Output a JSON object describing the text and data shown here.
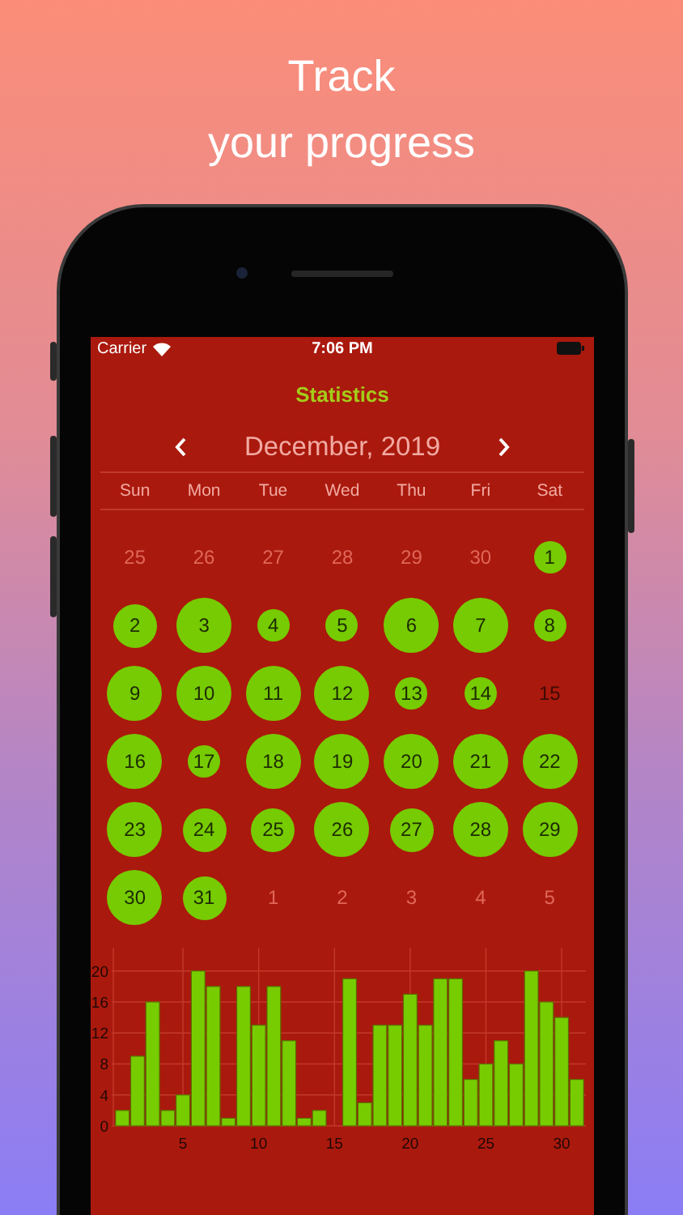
{
  "headline": {
    "lines": [
      "Track",
      "your progress"
    ]
  },
  "status_bar": {
    "carrier": "Carrier",
    "time": "7:06 PM"
  },
  "title": "Statistics",
  "calendar": {
    "month": "December, 2019",
    "weekdays": [
      "Sun",
      "Mon",
      "Tue",
      "Wed",
      "Thu",
      "Fri",
      "Sat"
    ],
    "days": [
      {
        "label": "25",
        "kind": "outside"
      },
      {
        "label": "26",
        "kind": "outside"
      },
      {
        "label": "27",
        "kind": "outside"
      },
      {
        "label": "28",
        "kind": "outside"
      },
      {
        "label": "29",
        "kind": "outside"
      },
      {
        "label": "30",
        "kind": "outside"
      },
      {
        "label": "1",
        "kind": "small"
      },
      {
        "label": "2",
        "kind": "medium"
      },
      {
        "label": "3",
        "kind": "large"
      },
      {
        "label": "4",
        "kind": "small"
      },
      {
        "label": "5",
        "kind": "small"
      },
      {
        "label": "6",
        "kind": "large"
      },
      {
        "label": "7",
        "kind": "large"
      },
      {
        "label": "8",
        "kind": "small"
      },
      {
        "label": "9",
        "kind": "large"
      },
      {
        "label": "10",
        "kind": "large"
      },
      {
        "label": "11",
        "kind": "large"
      },
      {
        "label": "12",
        "kind": "large"
      },
      {
        "label": "13",
        "kind": "small"
      },
      {
        "label": "14",
        "kind": "small"
      },
      {
        "label": "15",
        "kind": "missed"
      },
      {
        "label": "16",
        "kind": "large"
      },
      {
        "label": "17",
        "kind": "small"
      },
      {
        "label": "18",
        "kind": "large"
      },
      {
        "label": "19",
        "kind": "large"
      },
      {
        "label": "20",
        "kind": "large"
      },
      {
        "label": "21",
        "kind": "large"
      },
      {
        "label": "22",
        "kind": "large"
      },
      {
        "label": "23",
        "kind": "large"
      },
      {
        "label": "24",
        "kind": "medium"
      },
      {
        "label": "25",
        "kind": "medium"
      },
      {
        "label": "26",
        "kind": "large"
      },
      {
        "label": "27",
        "kind": "medium"
      },
      {
        "label": "28",
        "kind": "large"
      },
      {
        "label": "29",
        "kind": "large"
      },
      {
        "label": "30",
        "kind": "large"
      },
      {
        "label": "31",
        "kind": "medium"
      },
      {
        "label": "1",
        "kind": "outside"
      },
      {
        "label": "2",
        "kind": "outside"
      },
      {
        "label": "3",
        "kind": "outside"
      },
      {
        "label": "4",
        "kind": "outside"
      },
      {
        "label": "5",
        "kind": "outside"
      }
    ]
  },
  "chart": {
    "chart_data": {
      "type": "bar",
      "x": [
        1,
        2,
        3,
        4,
        5,
        6,
        7,
        8,
        9,
        10,
        11,
        12,
        13,
        14,
        15,
        16,
        17,
        18,
        19,
        20,
        21,
        22,
        23,
        24,
        25,
        26,
        27,
        28,
        29,
        30,
        31
      ],
      "series": [
        {
          "color": "#77cc00",
          "values": [
            2,
            9,
            16,
            2,
            4,
            20,
            18,
            1,
            18,
            13,
            18,
            11,
            1,
            2,
            null,
            19,
            3,
            13,
            13,
            17,
            13,
            19,
            19,
            6,
            8,
            11,
            8,
            20,
            16,
            14,
            6
          ]
        }
      ],
      "xlim": [
        0.4,
        31.6
      ],
      "ylim": [
        0,
        23
      ],
      "grid": true,
      "xticks": [
        5,
        10,
        15,
        20,
        25,
        30
      ],
      "yticks": [
        0,
        4,
        8,
        12,
        16,
        20
      ]
    }
  }
}
